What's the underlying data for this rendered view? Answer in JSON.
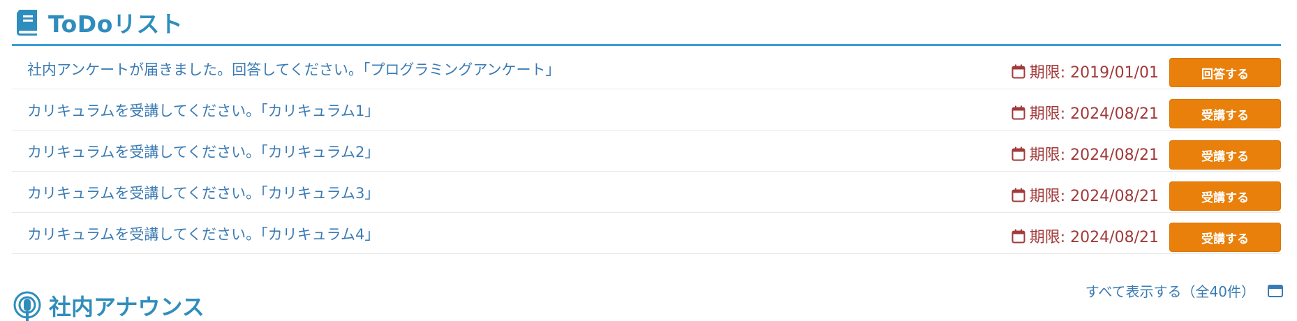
{
  "todo": {
    "title": "ToDoリスト",
    "header_icon": "book-icon",
    "due_icon": "calendar-icon",
    "items": [
      {
        "text": "社内アンケートが届きました。回答してください。「プログラミングアンケート」",
        "due": "期限: 2019/01/01",
        "action": "回答する"
      },
      {
        "text": "カリキュラムを受講してください。「カリキュラム1」",
        "due": "期限: 2024/08/21",
        "action": "受講する"
      },
      {
        "text": "カリキュラムを受講してください。「カリキュラム2」",
        "due": "期限: 2024/08/21",
        "action": "受講する"
      },
      {
        "text": "カリキュラムを受講してください。「カリキュラム3」",
        "due": "期限: 2024/08/21",
        "action": "受講する"
      },
      {
        "text": "カリキュラムを受講してください。「カリキュラム4」",
        "due": "期限: 2024/08/21",
        "action": "受講する"
      }
    ],
    "show_all_label": "すべて表示する（全40件）",
    "show_all_icon": "window-icon"
  },
  "announce": {
    "title": "社内アナウンス",
    "header_icon": "podcast-icon"
  },
  "colors": {
    "accent": "#2f8dbd",
    "rule": "#3a9ed3",
    "link_text": "#3a7bb3",
    "due_text": "#a23a3a",
    "button_bg": "#e8800b"
  }
}
